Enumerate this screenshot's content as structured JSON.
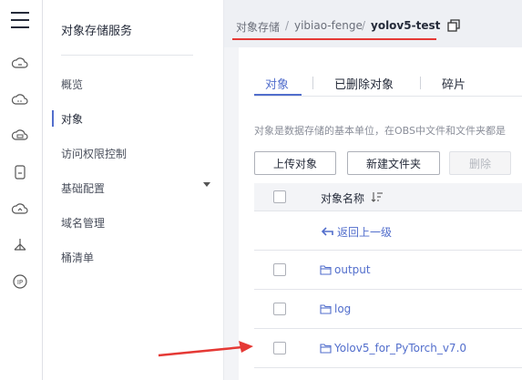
{
  "service": {
    "title": "对象存储服务",
    "menu": [
      {
        "label": "概览"
      },
      {
        "label": "对象"
      },
      {
        "label": "访问权限控制"
      },
      {
        "label": "基础配置"
      },
      {
        "label": "域名管理"
      },
      {
        "label": "桶清单"
      }
    ]
  },
  "breadcrumb": {
    "items": [
      "对象存储",
      "yibiao-fenge",
      "yolov5-test"
    ],
    "separator": "/"
  },
  "tabs": [
    "对象",
    "已删除对象",
    "碎片"
  ],
  "description": "对象是数据存储的基本单位，在OBS中文件和文件夹都是",
  "toolbar": {
    "upload": "上传对象",
    "new_folder": "新建文件夹",
    "delete": "删除"
  },
  "table": {
    "header": "对象名称",
    "back": "返回上一级",
    "rows": [
      {
        "name": "output"
      },
      {
        "name": "log"
      },
      {
        "name": "Yolov5_for_PyTorch_v7.0"
      }
    ]
  },
  "colors": {
    "accent": "#526ecc",
    "annotation": "#e53935"
  },
  "rail_icons": [
    "menu-icon",
    "cloud-server-icon",
    "cloud-icon",
    "database-icon",
    "storage-icon",
    "cloud-upload-icon",
    "network-icon",
    "ip-icon"
  ]
}
